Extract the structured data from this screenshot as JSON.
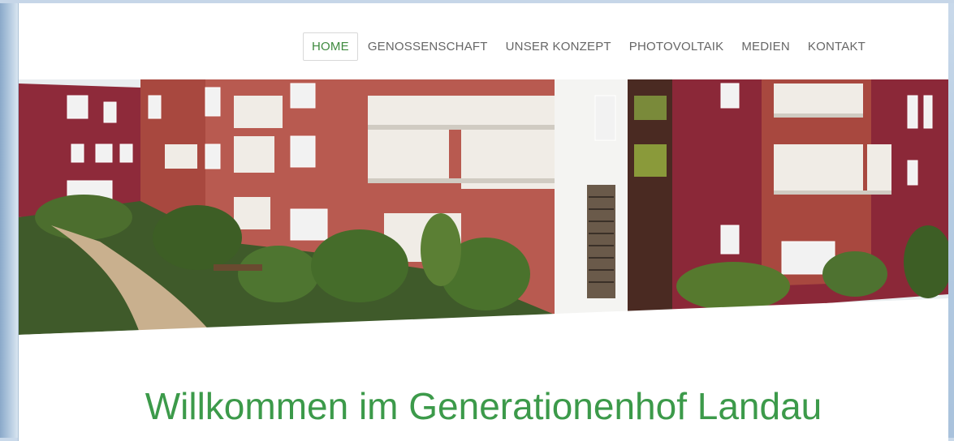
{
  "nav": {
    "items": [
      {
        "label": "HOME",
        "active": true
      },
      {
        "label": "GENOSSENSCHAFT",
        "active": false
      },
      {
        "label": "UNSER KONZEPT",
        "active": false
      },
      {
        "label": "PHOTOVOLTAIK",
        "active": false
      },
      {
        "label": "MEDIEN",
        "active": false
      },
      {
        "label": "KONTAKT",
        "active": false
      }
    ]
  },
  "main": {
    "title": "Willkommen im Generationenhof Landau"
  },
  "colors": {
    "accent_green": "#3c9a4a",
    "nav_text": "#666666",
    "background_blue": "#b7cde3"
  }
}
